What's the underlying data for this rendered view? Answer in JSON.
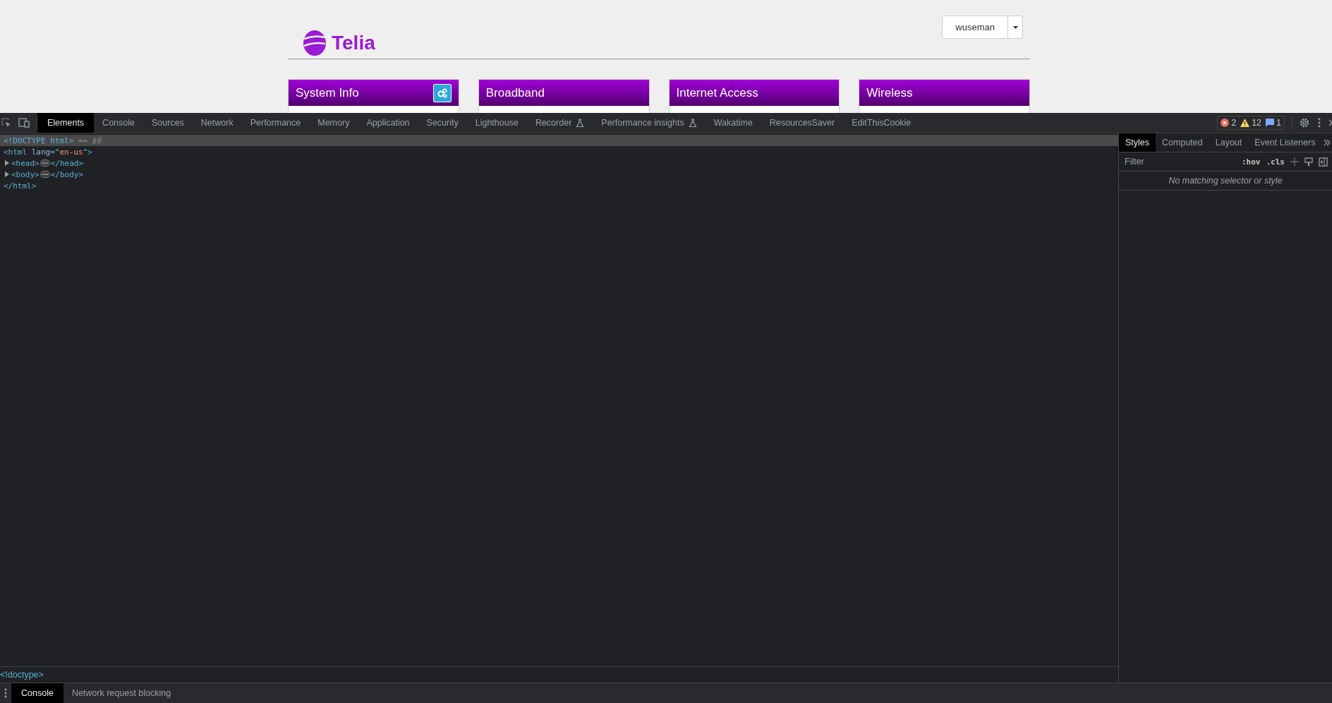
{
  "page": {
    "logo": "Telia",
    "user_menu": {
      "label": "wuseman"
    },
    "cards": [
      {
        "title": "System Info",
        "has_settings": true
      },
      {
        "title": "Broadband",
        "has_settings": false
      },
      {
        "title": "Internet Access",
        "has_settings": false
      },
      {
        "title": "Wireless",
        "has_settings": false
      }
    ]
  },
  "devtools": {
    "tabs": [
      {
        "label": "Elements",
        "selected": true,
        "experimental": false
      },
      {
        "label": "Console",
        "selected": false,
        "experimental": false
      },
      {
        "label": "Sources",
        "selected": false,
        "experimental": false
      },
      {
        "label": "Network",
        "selected": false,
        "experimental": false
      },
      {
        "label": "Performance",
        "selected": false,
        "experimental": false
      },
      {
        "label": "Memory",
        "selected": false,
        "experimental": false
      },
      {
        "label": "Application",
        "selected": false,
        "experimental": false
      },
      {
        "label": "Security",
        "selected": false,
        "experimental": false
      },
      {
        "label": "Lighthouse",
        "selected": false,
        "experimental": false
      },
      {
        "label": "Recorder",
        "selected": false,
        "experimental": true
      },
      {
        "label": "Performance insights",
        "selected": false,
        "experimental": true
      },
      {
        "label": "Wakatime",
        "selected": false,
        "experimental": false
      },
      {
        "label": "ResourcesSaver",
        "selected": false,
        "experimental": false
      },
      {
        "label": "EditThisCookie",
        "selected": false,
        "experimental": false
      }
    ],
    "counts": {
      "errors": "2",
      "warnings": "12",
      "messages": "1"
    },
    "dom": [
      {
        "kind": "doctype",
        "selected": true,
        "parts": [
          {
            "kind": "tag",
            "text": "<!DOCTYPE html>"
          },
          {
            "kind": "ref",
            "text": " == $0"
          }
        ]
      },
      {
        "kind": "line",
        "selected": false,
        "parts": [
          {
            "kind": "tag",
            "text": "<html "
          },
          {
            "kind": "attr",
            "text": "lang"
          },
          {
            "kind": "tag",
            "text": "=\""
          },
          {
            "kind": "value",
            "text": "en-us"
          },
          {
            "kind": "tag",
            "text": "\">"
          }
        ]
      },
      {
        "kind": "collapsed",
        "selected": false,
        "open": "<head>",
        "close": "</head>"
      },
      {
        "kind": "collapsed",
        "selected": false,
        "open": "<body>",
        "close": "</body>"
      },
      {
        "kind": "line",
        "selected": false,
        "parts": [
          {
            "kind": "tag",
            "text": "</html>"
          }
        ]
      }
    ],
    "breadcrumb": "<!doctype>",
    "styles": {
      "tabs": [
        {
          "label": "Styles",
          "selected": true
        },
        {
          "label": "Computed",
          "selected": false
        },
        {
          "label": "Layout",
          "selected": false
        },
        {
          "label": "Event Listeners",
          "selected": false
        }
      ],
      "filter": {
        "placeholder": "Filter"
      },
      "hov": ":hov",
      "cls": ".cls",
      "empty": "No matching selector or style"
    },
    "drawer_tabs": [
      {
        "label": "Console",
        "selected": true
      },
      {
        "label": "Network request blocking",
        "selected": false
      }
    ]
  }
}
